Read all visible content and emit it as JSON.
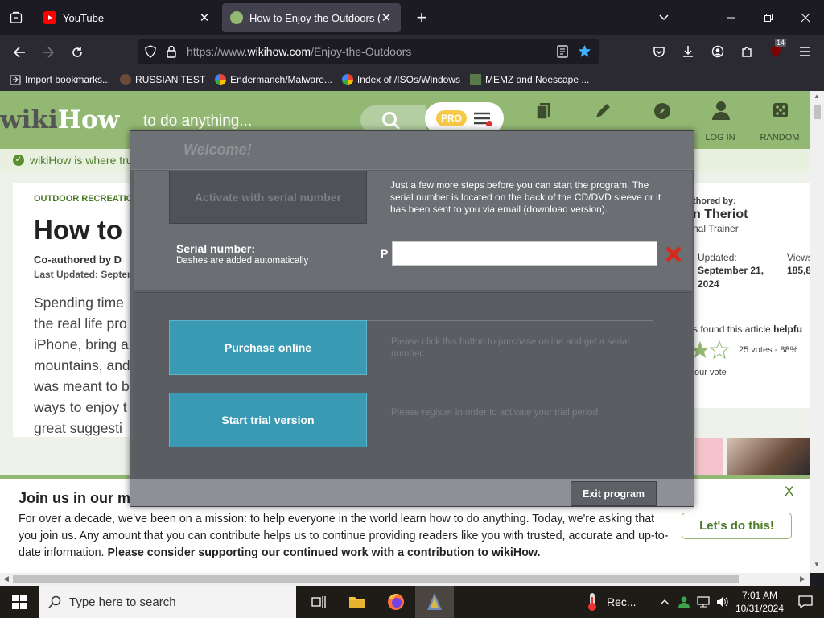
{
  "browser": {
    "tabs": [
      {
        "title": "YouTube",
        "active": false
      },
      {
        "title": "How to Enjoy the Outdoors (wi",
        "active": true
      }
    ],
    "url": {
      "prefix": "https://www.",
      "domain": "wikihow.com",
      "path": "/Enjoy-the-Outdoors"
    },
    "notification_count": "14",
    "bookmarks": [
      "Import bookmarks...",
      "RUSSIAN TEST",
      "Endermanch/Malware...",
      "Index of /ISOs/Windows",
      "MEMZ and Noescape ..."
    ]
  },
  "wikihow": {
    "logo_wiki": "wiki",
    "logo_how": "How",
    "tagline": "to do anything...",
    "pro_badge": "PRO",
    "nav": [
      {
        "label": "",
        "icon": "cards-icon"
      },
      {
        "label": "",
        "icon": "pencil-icon"
      },
      {
        "label": "",
        "icon": "compass-icon"
      },
      {
        "label": "LOG IN",
        "icon": "person-icon"
      },
      {
        "label": "RANDOM",
        "icon": "dice-icon"
      }
    ],
    "trust_strip": "wikiHow is where tru",
    "category": "OUTDOOR RECREATION",
    "article_title": "How to",
    "coauthored": "Co-authored by D",
    "last_updated": "Last Updated: Septer",
    "intro_lines": [
      "Spending time",
      "the real life pro",
      "iPhone, bring a",
      "mountains, and",
      "was meant to b",
      "ways to enjoy t",
      "great suggesti"
    ],
    "side": {
      "coauthored_by": "thored by:",
      "author": "n Theriot",
      "role": "nal Trainer",
      "updated_label": "Updated:",
      "updated_date_1": "September 21,",
      "updated_date_2": "2024",
      "views_label": "Views",
      "views_value": "185,8",
      "helpful_text": "s found this article ",
      "helpful_bold": "helpfu",
      "votes": "25 votes - 88%",
      "your_vote": "our vote"
    },
    "join": {
      "title": "Join us in our m",
      "body": "For over a decade, we've been on a mission: to help everyone in the world learn how to do anything. Today, we're asking that you join us. Any amount that you can contribute helps us to continue providing readers like you with trusted, accurate and up-to-date information. ",
      "body_bold": "Please consider supporting our continued work with a contribution to wikiHow.",
      "button": "Let's do this!",
      "close": "X"
    }
  },
  "dialog": {
    "title": "Welcome!",
    "activate_button": "Activate with serial number",
    "description": "Just a few more steps before you can start the program. The serial number is located on the back of the CD/DVD sleeve or it has been sent to you via email (download version).",
    "serial_label": "Serial number:",
    "serial_sub": "Dashes are added automatically",
    "serial_prefix": "P",
    "serial_value": "",
    "purchase_button": "Purchase online",
    "purchase_desc": "Please click this button to purchase online and get a serial number.",
    "trial_button": "Start trial version",
    "trial_desc": "Please register in order to activate your trial period.",
    "exit_button": "Exit program"
  },
  "taskbar": {
    "search_placeholder": "Type here to search",
    "weather_label": "Rec...",
    "time": "7:01 AM",
    "date": "10/31/2024"
  }
}
